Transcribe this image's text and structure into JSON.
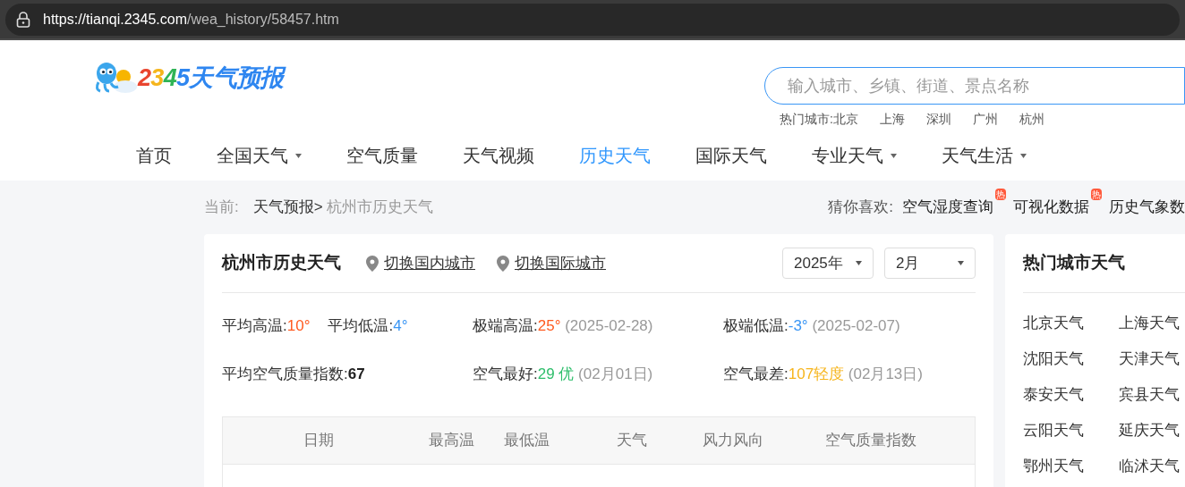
{
  "browser": {
    "url_host": "https://tianqi.2345.com",
    "url_path": "/wea_history/58457.htm"
  },
  "logo": {
    "parts": [
      {
        "text": "2",
        "color": "#e9452f"
      },
      {
        "text": "3",
        "color": "#f5b51c"
      },
      {
        "text": "4",
        "color": "#2fb455"
      },
      {
        "text": "5",
        "color": "#2e86f0"
      },
      {
        "text": "天气预报",
        "color": "#2e86f0"
      }
    ]
  },
  "search": {
    "placeholder": "输入城市、乡镇、街道、景点名称"
  },
  "hot_cities": {
    "label": "热门城市:",
    "items": [
      "北京",
      "上海",
      "深圳",
      "广州",
      "杭州"
    ]
  },
  "nav": [
    {
      "label": "首页",
      "selected": false,
      "dropdown": false
    },
    {
      "label": "全国天气",
      "selected": false,
      "dropdown": true
    },
    {
      "label": "空气质量",
      "selected": false,
      "dropdown": false
    },
    {
      "label": "天气视频",
      "selected": false,
      "dropdown": false
    },
    {
      "label": "历史天气",
      "selected": true,
      "dropdown": false
    },
    {
      "label": "国际天气",
      "selected": false,
      "dropdown": false
    },
    {
      "label": "专业天气",
      "selected": false,
      "dropdown": true
    },
    {
      "label": "天气生活",
      "selected": false,
      "dropdown": true
    }
  ],
  "breadcrumb": {
    "label": "当前:",
    "home": "天气预报>",
    "current": "杭州市历史天气"
  },
  "suggest": {
    "label": "猜你喜欢:",
    "items": [
      {
        "text": "空气湿度查询",
        "badge": "热"
      },
      {
        "text": "可视化数据",
        "badge": "热"
      },
      {
        "text": "历史气象数"
      }
    ]
  },
  "history": {
    "title": "杭州市历史天气",
    "switch_links": [
      "切换国内城市",
      "切换国际城市"
    ],
    "year": "2025年",
    "month": "2月",
    "stats": [
      {
        "label": "平均高温:",
        "value": "10°",
        "color": "#ff5a1f"
      },
      {
        "label": "平均低温:",
        "value": "4°",
        "color": "#3a96f5"
      },
      {
        "label": "极端高温:",
        "value": "25°",
        "color": "#ff5a1f",
        "note": "(2025-02-28)"
      },
      {
        "label": "极端低温:",
        "value": "-3°",
        "color": "#3a96f5",
        "note": "(2025-02-07)"
      },
      {
        "label": "平均空气质量指数:",
        "value": "67",
        "color": "#222222"
      },
      {
        "label": "空气最好:",
        "value": "29 优",
        "color": "#2ebe6b",
        "note": "(02月01日)"
      },
      {
        "label": "空气最差:",
        "value": "107轻度",
        "color": "#f6b51d",
        "note": "(02月13日)"
      }
    ],
    "table": {
      "columns": [
        "日期",
        "最高温",
        "最低温",
        "天气",
        "风力风向",
        "空气质量指数"
      ]
    }
  },
  "hot_city_weather": {
    "title": "热门城市天气",
    "items": [
      "北京天气",
      "上海天气",
      "沈阳天气",
      "天津天气",
      "泰安天气",
      "宾县天气",
      "云阳天气",
      "延庆天气",
      "鄂州天气",
      "临沭天气"
    ]
  }
}
